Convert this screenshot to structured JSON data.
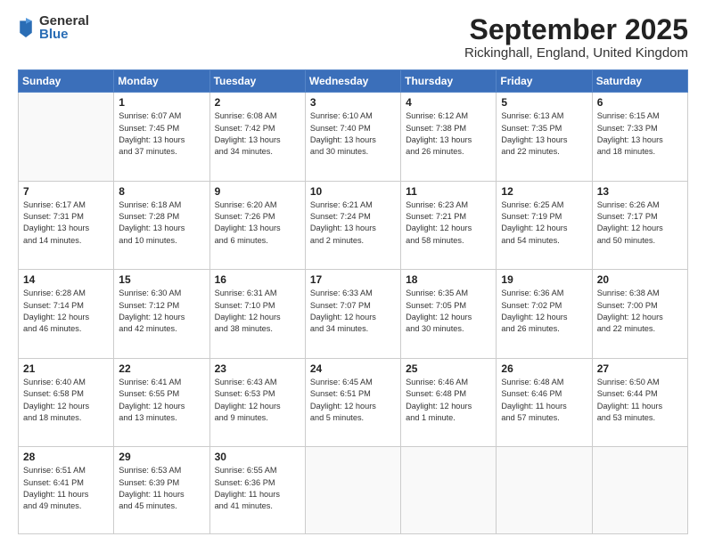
{
  "logo": {
    "general": "General",
    "blue": "Blue"
  },
  "header": {
    "month": "September 2025",
    "location": "Rickinghall, England, United Kingdom"
  },
  "weekdays": [
    "Sunday",
    "Monday",
    "Tuesday",
    "Wednesday",
    "Thursday",
    "Friday",
    "Saturday"
  ],
  "weeks": [
    [
      {
        "day": "",
        "info": ""
      },
      {
        "day": "1",
        "info": "Sunrise: 6:07 AM\nSunset: 7:45 PM\nDaylight: 13 hours\nand 37 minutes."
      },
      {
        "day": "2",
        "info": "Sunrise: 6:08 AM\nSunset: 7:42 PM\nDaylight: 13 hours\nand 34 minutes."
      },
      {
        "day": "3",
        "info": "Sunrise: 6:10 AM\nSunset: 7:40 PM\nDaylight: 13 hours\nand 30 minutes."
      },
      {
        "day": "4",
        "info": "Sunrise: 6:12 AM\nSunset: 7:38 PM\nDaylight: 13 hours\nand 26 minutes."
      },
      {
        "day": "5",
        "info": "Sunrise: 6:13 AM\nSunset: 7:35 PM\nDaylight: 13 hours\nand 22 minutes."
      },
      {
        "day": "6",
        "info": "Sunrise: 6:15 AM\nSunset: 7:33 PM\nDaylight: 13 hours\nand 18 minutes."
      }
    ],
    [
      {
        "day": "7",
        "info": "Sunrise: 6:17 AM\nSunset: 7:31 PM\nDaylight: 13 hours\nand 14 minutes."
      },
      {
        "day": "8",
        "info": "Sunrise: 6:18 AM\nSunset: 7:28 PM\nDaylight: 13 hours\nand 10 minutes."
      },
      {
        "day": "9",
        "info": "Sunrise: 6:20 AM\nSunset: 7:26 PM\nDaylight: 13 hours\nand 6 minutes."
      },
      {
        "day": "10",
        "info": "Sunrise: 6:21 AM\nSunset: 7:24 PM\nDaylight: 13 hours\nand 2 minutes."
      },
      {
        "day": "11",
        "info": "Sunrise: 6:23 AM\nSunset: 7:21 PM\nDaylight: 12 hours\nand 58 minutes."
      },
      {
        "day": "12",
        "info": "Sunrise: 6:25 AM\nSunset: 7:19 PM\nDaylight: 12 hours\nand 54 minutes."
      },
      {
        "day": "13",
        "info": "Sunrise: 6:26 AM\nSunset: 7:17 PM\nDaylight: 12 hours\nand 50 minutes."
      }
    ],
    [
      {
        "day": "14",
        "info": "Sunrise: 6:28 AM\nSunset: 7:14 PM\nDaylight: 12 hours\nand 46 minutes."
      },
      {
        "day": "15",
        "info": "Sunrise: 6:30 AM\nSunset: 7:12 PM\nDaylight: 12 hours\nand 42 minutes."
      },
      {
        "day": "16",
        "info": "Sunrise: 6:31 AM\nSunset: 7:10 PM\nDaylight: 12 hours\nand 38 minutes."
      },
      {
        "day": "17",
        "info": "Sunrise: 6:33 AM\nSunset: 7:07 PM\nDaylight: 12 hours\nand 34 minutes."
      },
      {
        "day": "18",
        "info": "Sunrise: 6:35 AM\nSunset: 7:05 PM\nDaylight: 12 hours\nand 30 minutes."
      },
      {
        "day": "19",
        "info": "Sunrise: 6:36 AM\nSunset: 7:02 PM\nDaylight: 12 hours\nand 26 minutes."
      },
      {
        "day": "20",
        "info": "Sunrise: 6:38 AM\nSunset: 7:00 PM\nDaylight: 12 hours\nand 22 minutes."
      }
    ],
    [
      {
        "day": "21",
        "info": "Sunrise: 6:40 AM\nSunset: 6:58 PM\nDaylight: 12 hours\nand 18 minutes."
      },
      {
        "day": "22",
        "info": "Sunrise: 6:41 AM\nSunset: 6:55 PM\nDaylight: 12 hours\nand 13 minutes."
      },
      {
        "day": "23",
        "info": "Sunrise: 6:43 AM\nSunset: 6:53 PM\nDaylight: 12 hours\nand 9 minutes."
      },
      {
        "day": "24",
        "info": "Sunrise: 6:45 AM\nSunset: 6:51 PM\nDaylight: 12 hours\nand 5 minutes."
      },
      {
        "day": "25",
        "info": "Sunrise: 6:46 AM\nSunset: 6:48 PM\nDaylight: 12 hours\nand 1 minute."
      },
      {
        "day": "26",
        "info": "Sunrise: 6:48 AM\nSunset: 6:46 PM\nDaylight: 11 hours\nand 57 minutes."
      },
      {
        "day": "27",
        "info": "Sunrise: 6:50 AM\nSunset: 6:44 PM\nDaylight: 11 hours\nand 53 minutes."
      }
    ],
    [
      {
        "day": "28",
        "info": "Sunrise: 6:51 AM\nSunset: 6:41 PM\nDaylight: 11 hours\nand 49 minutes."
      },
      {
        "day": "29",
        "info": "Sunrise: 6:53 AM\nSunset: 6:39 PM\nDaylight: 11 hours\nand 45 minutes."
      },
      {
        "day": "30",
        "info": "Sunrise: 6:55 AM\nSunset: 6:36 PM\nDaylight: 11 hours\nand 41 minutes."
      },
      {
        "day": "",
        "info": ""
      },
      {
        "day": "",
        "info": ""
      },
      {
        "day": "",
        "info": ""
      },
      {
        "day": "",
        "info": ""
      }
    ]
  ]
}
